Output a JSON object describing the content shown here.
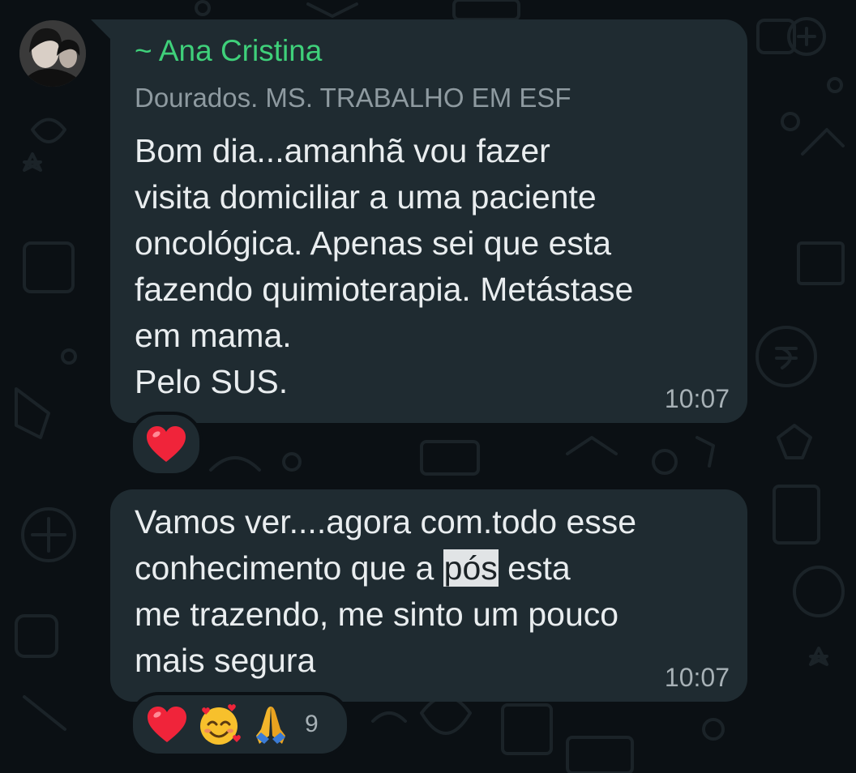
{
  "messages": [
    {
      "sender": "~ Ana Cristina",
      "sender_subtitle": "Dourados. MS. TRABALHO EM ESF",
      "text": "Bom dia...amanhã vou fazer\nvisita domiciliar a uma paciente\noncológica. Apenas sei que esta\nfazendo quimioterapia. Metástase\nem mama.\nPelo SUS.",
      "time": "10:07",
      "reactions": [
        "heart-emoji"
      ]
    },
    {
      "text_before_highlight": "Vamos ver....agora com.todo esse\nconhecimento que a ",
      "highlighted_word": "pós",
      "text_after_highlight": " esta\nme trazendo, me sinto um pouco\nmais segura",
      "time": "10:07",
      "reactions": [
        "heart-emoji",
        "smiling-face-with-hearts-emoji",
        "folded-hands-emoji"
      ],
      "reaction_count": "9"
    }
  ],
  "colors": {
    "background": "#0b1014",
    "bubble": "#1f2b31",
    "sender_name": "#3fd07a",
    "subtitle": "#8e9aa0",
    "text": "#e9edef",
    "timestamp": "#a7b1b6"
  }
}
